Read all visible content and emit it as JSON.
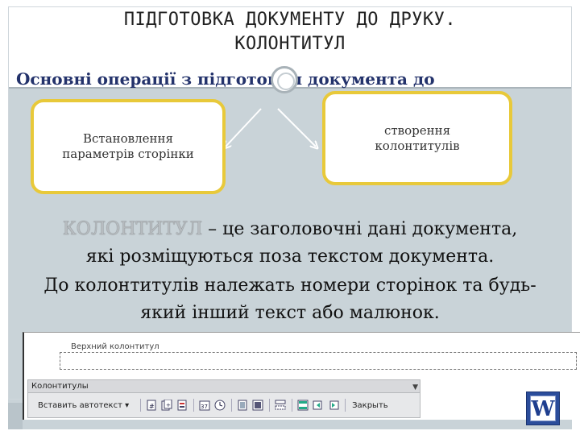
{
  "slide": {
    "title_line1": "ПІДГОТОВКА ДОКУМЕНТУ ДО ДРУКУ.",
    "title_line2": "КОЛОНТИТУЛ",
    "subtitle": "Основні операції з підготовки документа до",
    "box1_text": "Встановлення\nпараметрів сторінки",
    "box2_text": "створення\nколонтитулів",
    "definition_keyword": "КОЛОНТИТУЛ",
    "definition_line1_rest": " – це заголовочні дані документа,",
    "definition_line2": "які розміщуються поза текстом документа.",
    "definition_line3": "До колонтитулів належать номери сторінок та будь-",
    "definition_line4": "який інший текст або малюнок."
  },
  "word": {
    "header_label": "Верхний колонтитул",
    "toolbar_title": "Колонтитулы",
    "insert_autotext": "Вставить автотекст",
    "close_label": "Закрыть",
    "logo_letter": "W",
    "icons": [
      "insert-page-number-icon",
      "insert-page-count-icon",
      "format-page-number-icon",
      "insert-date-icon",
      "insert-time-icon",
      "page-setup-icon",
      "show-hide-text-icon",
      "same-as-previous-icon",
      "switch-header-footer-icon",
      "show-previous-icon",
      "show-next-icon"
    ]
  },
  "colors": {
    "title": "#222222",
    "subtitle": "#23326b",
    "box_border": "#e8c93a",
    "content_bg": "#c9d3d8",
    "word_blue": "#2b4d9b"
  }
}
